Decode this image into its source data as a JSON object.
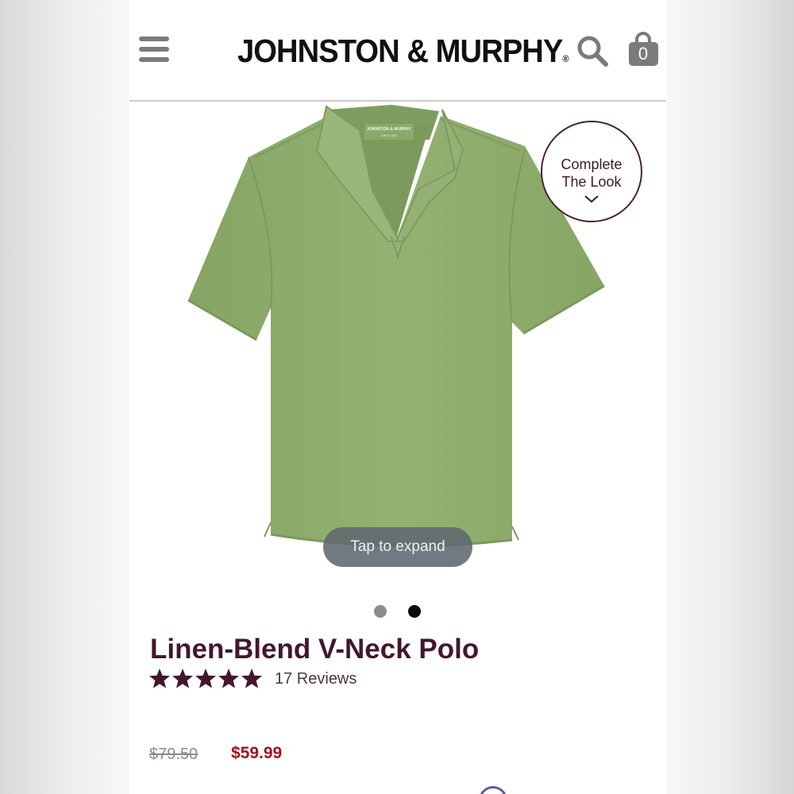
{
  "header": {
    "menu_icon": "hamburger-menu-icon",
    "brand": "JOHNSTON & MURPHY",
    "brand_mark": "®",
    "search_icon": "search-icon",
    "bag_icon": "shopping-bag-icon",
    "bag_count": "0"
  },
  "gallery": {
    "complete_the_look_line1": "Complete",
    "complete_the_look_line2": "The Look",
    "tap_to_expand": "Tap to expand",
    "current_image": 2,
    "total_images": 2
  },
  "product": {
    "title": "Linen-Blend V-Neck Polo",
    "rating": 5,
    "rating_max": 5,
    "reviews_label": "17 Reviews",
    "original_price": "$79.50",
    "sale_price": "$59.99",
    "shirt_color": "#8faf6c"
  },
  "colors": {
    "brand_text": "#43172d",
    "sale_price": "#a3121f",
    "header_icons": "#7b7b7b"
  }
}
